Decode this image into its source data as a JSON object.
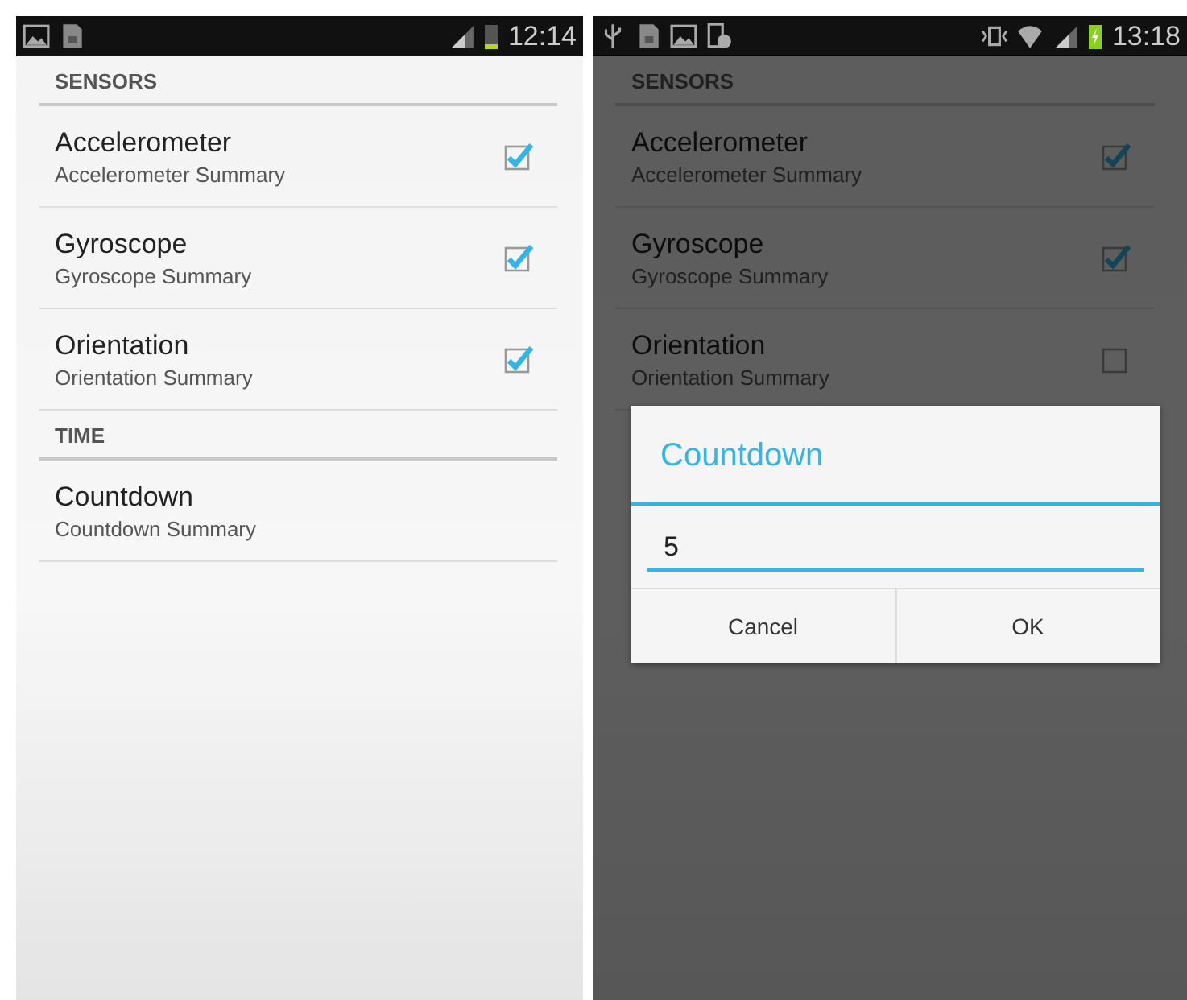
{
  "screens": [
    {
      "status_bar": {
        "notifications": [
          {
            "kind": "image"
          },
          {
            "kind": "sd-card"
          }
        ],
        "indicators": [
          {
            "kind": "signal"
          },
          {
            "kind": "battery"
          }
        ],
        "time": "12:14"
      },
      "dimmed": false,
      "categories": [
        {
          "title": "SENSORS",
          "items": [
            {
              "kind": "checkbox",
              "title": "Accelerometer",
              "summary": "Accelerometer Summary",
              "checked": true
            },
            {
              "kind": "checkbox",
              "title": "Gyroscope",
              "summary": "Gyroscope Summary",
              "checked": true
            },
            {
              "kind": "checkbox",
              "title": "Orientation",
              "summary": "Orientation Summary",
              "checked": true
            }
          ]
        },
        {
          "title": "TIME",
          "items": [
            {
              "kind": "text",
              "title": "Countdown",
              "summary": "Countdown Summary"
            }
          ]
        }
      ]
    },
    {
      "status_bar": {
        "notifications": [
          {
            "kind": "usb"
          },
          {
            "kind": "sd-card"
          },
          {
            "kind": "image"
          },
          {
            "kind": "device-clock"
          }
        ],
        "indicators": [
          {
            "kind": "vibrate"
          },
          {
            "kind": "wifi"
          },
          {
            "kind": "signal"
          },
          {
            "kind": "battery-charging"
          }
        ],
        "time": "13:18"
      },
      "dimmed": true,
      "categories": [
        {
          "title": "SENSORS",
          "items": [
            {
              "kind": "checkbox",
              "title": "Accelerometer",
              "summary": "Accelerometer Summary",
              "checked": true
            },
            {
              "kind": "checkbox",
              "title": "Gyroscope",
              "summary": "Gyroscope Summary",
              "checked": true
            },
            {
              "kind": "checkbox",
              "title": "Orientation",
              "summary": "Orientation Summary",
              "checked": false
            }
          ]
        }
      ],
      "dialog": {
        "title": "Countdown",
        "value": "5",
        "buttons": [
          "Cancel",
          "OK"
        ]
      }
    }
  ]
}
